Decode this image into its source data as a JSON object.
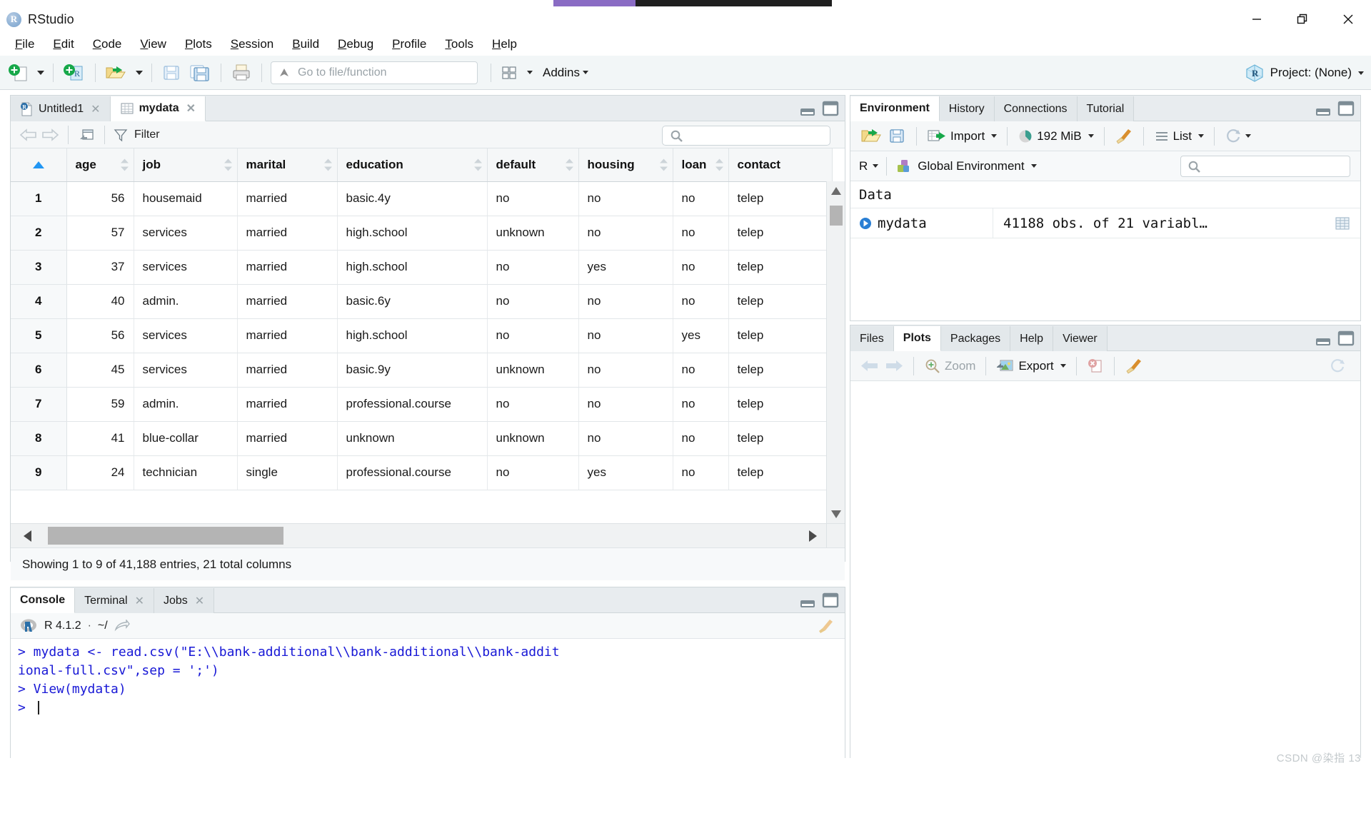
{
  "app": {
    "title": "RStudio",
    "logo_letter": "R"
  },
  "window_controls": {
    "minimize": "minimize-icon",
    "restore": "restore-icon",
    "close": "close-icon"
  },
  "menubar": {
    "items": [
      {
        "label": "File",
        "mnemonic": "F"
      },
      {
        "label": "Edit",
        "mnemonic": "E"
      },
      {
        "label": "Code",
        "mnemonic": "C"
      },
      {
        "label": "View",
        "mnemonic": "V"
      },
      {
        "label": "Plots",
        "mnemonic": "P"
      },
      {
        "label": "Session",
        "mnemonic": "S"
      },
      {
        "label": "Build",
        "mnemonic": "B"
      },
      {
        "label": "Debug",
        "mnemonic": "D"
      },
      {
        "label": "Profile",
        "mnemonic": "P"
      },
      {
        "label": "Tools",
        "mnemonic": "T"
      },
      {
        "label": "Help",
        "mnemonic": "H"
      }
    ]
  },
  "toolbar": {
    "new_file_icon": "new-file-icon",
    "new_project_icon": "new-project-icon",
    "open_file_icon": "open-file-icon",
    "save_icon": "save-icon",
    "save_all_icon": "save-all-icon",
    "print_icon": "print-icon",
    "goto_placeholder": "Go to file/function",
    "goto_value": "",
    "pane_layout_icon": "pane-layout-icon",
    "addins_label": "Addins",
    "project_label": "Project: (None)",
    "project_icon": "r-project-cube-icon"
  },
  "source_pane": {
    "tabs": [
      {
        "label": "Untitled1",
        "icon": "r-script-icon",
        "closable": true,
        "active": false
      },
      {
        "label": "mydata",
        "icon": "data-grid-icon",
        "closable": true,
        "active": true
      }
    ],
    "viewer_toolbar": {
      "back_icon": "arrow-left-icon",
      "forward_icon": "arrow-right-icon",
      "popout_icon": "show-in-new-window-icon",
      "filter_label": "Filter",
      "filter_icon": "funnel-icon",
      "search_placeholder": "",
      "search_value": "",
      "search_icon": "search-icon"
    },
    "table": {
      "columns": [
        "age",
        "job",
        "marital",
        "education",
        "default",
        "housing",
        "loan",
        "contact"
      ],
      "sorted_column": "rownum",
      "sort_direction": "asc",
      "rows": [
        {
          "n": "1",
          "age": "56",
          "job": "housemaid",
          "marital": "married",
          "education": "basic.4y",
          "default": "no",
          "housing": "no",
          "loan": "no",
          "contact": "telep"
        },
        {
          "n": "2",
          "age": "57",
          "job": "services",
          "marital": "married",
          "education": "high.school",
          "default": "unknown",
          "housing": "no",
          "loan": "no",
          "contact": "telep"
        },
        {
          "n": "3",
          "age": "37",
          "job": "services",
          "marital": "married",
          "education": "high.school",
          "default": "no",
          "housing": "yes",
          "loan": "no",
          "contact": "telep"
        },
        {
          "n": "4",
          "age": "40",
          "job": "admin.",
          "marital": "married",
          "education": "basic.6y",
          "default": "no",
          "housing": "no",
          "loan": "no",
          "contact": "telep"
        },
        {
          "n": "5",
          "age": "56",
          "job": "services",
          "marital": "married",
          "education": "high.school",
          "default": "no",
          "housing": "no",
          "loan": "yes",
          "contact": "telep"
        },
        {
          "n": "6",
          "age": "45",
          "job": "services",
          "marital": "married",
          "education": "basic.9y",
          "default": "unknown",
          "housing": "no",
          "loan": "no",
          "contact": "telep"
        },
        {
          "n": "7",
          "age": "59",
          "job": "admin.",
          "marital": "married",
          "education": "professional.course",
          "default": "no",
          "housing": "no",
          "loan": "no",
          "contact": "telep"
        },
        {
          "n": "8",
          "age": "41",
          "job": "blue-collar",
          "marital": "married",
          "education": "unknown",
          "default": "unknown",
          "housing": "no",
          "loan": "no",
          "contact": "telep"
        },
        {
          "n": "9",
          "age": "24",
          "job": "technician",
          "marital": "single",
          "education": "professional.course",
          "default": "no",
          "housing": "yes",
          "loan": "no",
          "contact": "telep"
        }
      ]
    },
    "status": "Showing 1 to 9 of 41,188 entries, 21 total columns"
  },
  "console_pane": {
    "tabs": [
      {
        "label": "Console",
        "closable": false,
        "active": true
      },
      {
        "label": "Terminal",
        "closable": true,
        "active": false
      },
      {
        "label": "Jobs",
        "closable": true,
        "active": false
      }
    ],
    "version": "R 4.1.2",
    "separator": "·",
    "working_dir": "~/",
    "popout_icon": "open-in-window-icon",
    "broom_icon": "clear-console-icon",
    "r_logo_icon": "r-logo-icon",
    "lines": [
      "> mydata <- read.csv(\"E:\\\\bank-additional\\\\bank-additional\\\\bank-addit",
      "ional-full.csv\",sep = ';')",
      "> View(mydata)",
      "> "
    ],
    "text_color": "#1818d6"
  },
  "environment_pane": {
    "tabs": [
      {
        "label": "Environment",
        "active": true
      },
      {
        "label": "History",
        "active": false
      },
      {
        "label": "Connections",
        "active": false
      },
      {
        "label": "Tutorial",
        "active": false
      }
    ],
    "toolbar": {
      "load_icon": "load-workspace-icon",
      "save_icon": "save-workspace-icon",
      "import_label": "Import",
      "import_icon": "import-dataset-icon",
      "memory_label": "192 MiB",
      "memory_icon": "memory-usage-icon",
      "clear_icon": "broom-clear-icon",
      "view_label": "List",
      "view_icon": "list-view-icon",
      "refresh_icon": "refresh-icon"
    },
    "scope": {
      "language": "R",
      "environment_label": "Global Environment",
      "environment_icon": "global-environment-icon",
      "search_placeholder": "",
      "search_value": "",
      "search_icon": "search-icon"
    },
    "section_label": "Data",
    "objects": [
      {
        "name": "mydata",
        "value": "41188 obs. of 21 variabl…",
        "expand_icon": "expand-object-icon",
        "view_icon": "view-data-grid-icon"
      }
    ]
  },
  "plots_pane": {
    "tabs": [
      {
        "label": "Files",
        "active": false
      },
      {
        "label": "Plots",
        "active": true
      },
      {
        "label": "Packages",
        "active": false
      },
      {
        "label": "Help",
        "active": false
      },
      {
        "label": "Viewer",
        "active": false
      }
    ],
    "toolbar": {
      "back_icon": "arrow-left-icon",
      "forward_icon": "arrow-right-icon",
      "zoom_label": "Zoom",
      "zoom_icon": "magnifier-plus-icon",
      "export_label": "Export",
      "export_icon": "export-image-icon",
      "remove_icon": "remove-plot-icon",
      "clear_all_icon": "clear-all-plots-icon",
      "refresh_icon": "refresh-icon"
    }
  },
  "pane_controls": {
    "minimize_icon": "pane-minimize-icon",
    "maximize_icon": "pane-maximize-icon"
  },
  "watermark": "CSDN @染指 13",
  "colors": {
    "accent_purple": "#8a6cc4",
    "accent_dark": "#1f1f1f",
    "toolbar_bg": "#f2f6f7",
    "tab_active_bg": "#ffffff",
    "tab_inactive_bg": "#e3e8eb",
    "console_text": "#1818d6",
    "sort_arrow": "#2196f3"
  }
}
